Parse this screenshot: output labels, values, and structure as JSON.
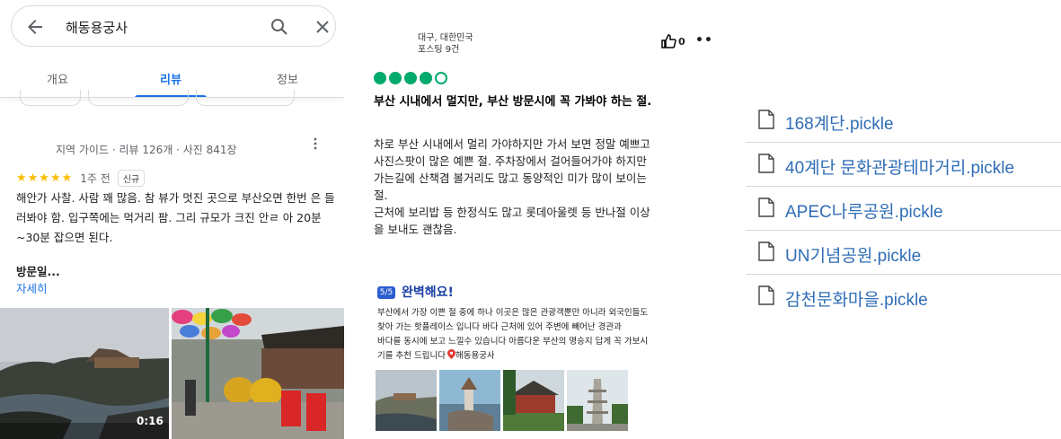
{
  "maps": {
    "search": {
      "query": "해동용궁사"
    },
    "tabs": [
      {
        "label": "개요"
      },
      {
        "label": "리뷰"
      },
      {
        "label": "정보"
      }
    ],
    "review": {
      "reviewer_meta": "지역 가이드 · 리뷰 126개 · 사진 841장",
      "stars": "★★★★★",
      "rating": 5,
      "age": "1주 전",
      "badge": "신규",
      "text": "해안가 사찰. 사람 꽤 많음. 참 뷰가 멋진 곳으로 부산오면 한번 은 들러봐야 함. 입구쪽에는 먹거리 팜. 그리 규모가 크진 안ㄹ 아 20분~30분 잡으면 된다.",
      "visit_label": "방문일...",
      "more_label": "자세히",
      "video_duration": "0:16"
    }
  },
  "tripadvisor": {
    "location": "대구, 대한민국",
    "posts": "포스팅 9건",
    "likes": "0",
    "bubble_rating": 4,
    "bubble_max": 5,
    "title": "부산 시내에서 멀지만, 부산 방문시에 꼭 가봐야 하는 절.",
    "body_lines": [
      "차로 부산 시내에서 멀리 가야하지만 가서 보면 정말 예쁘고",
      "사진스팟이 많은 예쁜 절. 주차장에서 걸어들어가야 하지만",
      "가는길에 산책겸 볼거리도 많고 동양적인 미가 많이 보이는",
      "절.",
      "근처에 보리밥 등 한정식도 많고 롯데아울렛 등 반나절 이상",
      "을 보내도 괜찮음."
    ],
    "rating_badge": "5/5",
    "rating_title": "완벽해요!",
    "rating_body_lines": [
      "부산에서 가장 이쁜 절 중에 하나 이곳은 많은 관광객뿐만 아니라 외국인들도",
      "찾아 가는 핫플레이스 입니다 바다 근처에 있어 주변에 빼어난 경관과",
      "바다를 동시에 보고 느낄수 있습니다 아름다운 부산의 명승지 답게 꼭 가보시",
      "기를 추천 드립니다"
    ],
    "rating_place": "해동용궁사"
  },
  "files": [
    {
      "name": "168계단.pickle"
    },
    {
      "name": "40계단 문화관광테마거리.pickle"
    },
    {
      "name": "APEC나루공원.pickle"
    },
    {
      "name": "UN기념공원.pickle"
    },
    {
      "name": "감천문화마을.pickle"
    }
  ],
  "colors": {
    "google_blue": "#1a73e8",
    "star": "#fbbc04",
    "ta_green": "#00aa6c",
    "file_link": "#2f6db5"
  }
}
